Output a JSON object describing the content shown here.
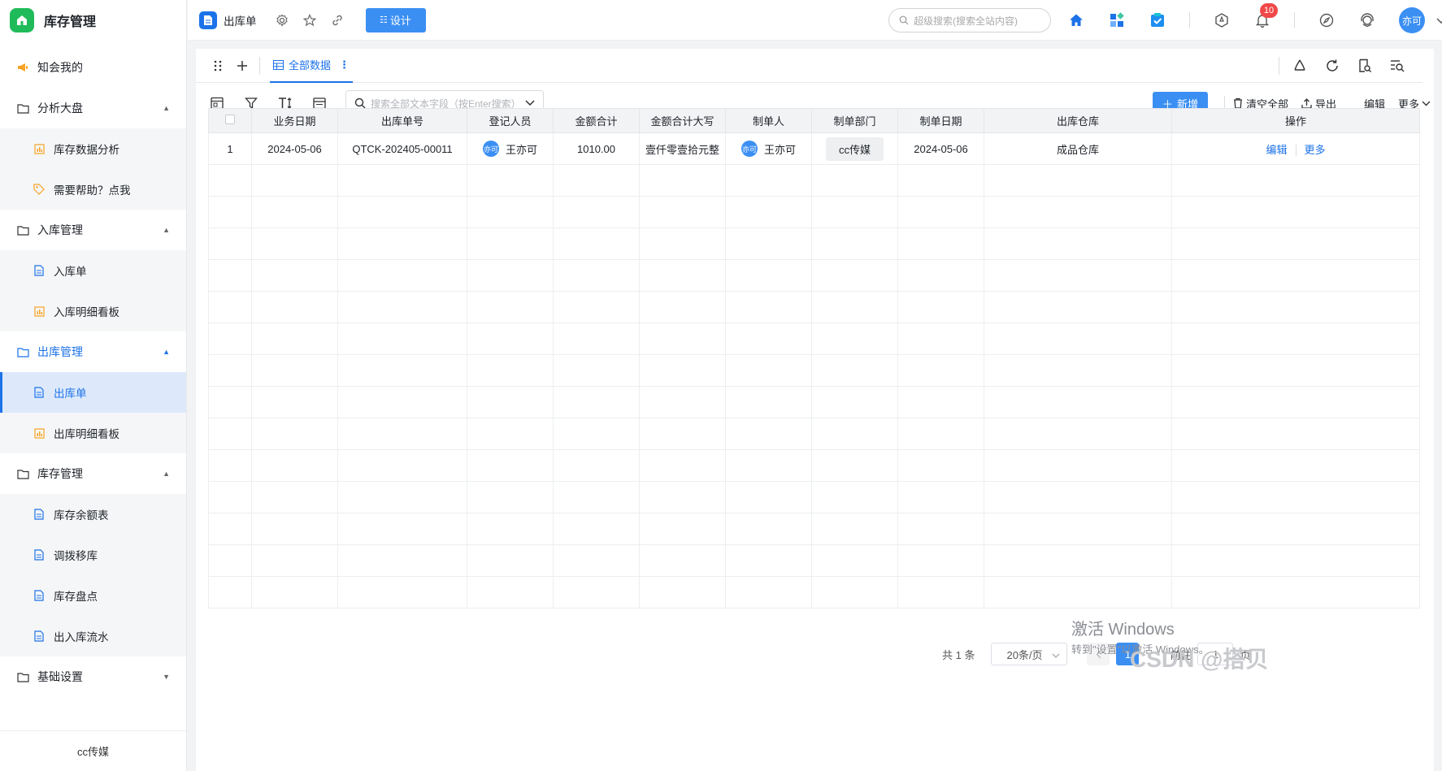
{
  "app": {
    "title": "库存管理",
    "footer": "cc传媒"
  },
  "sidebar": {
    "top_item": "知会我的",
    "groups": [
      {
        "label": "分析大盘",
        "items": [
          "库存数据分析",
          "需要帮助？点我"
        ]
      },
      {
        "label": "入库管理",
        "items": [
          "入库单",
          "入库明细看板"
        ]
      },
      {
        "label": "出库管理",
        "items": [
          "出库单",
          "出库明细看板"
        ]
      },
      {
        "label": "库存管理",
        "items": [
          "库存余额表",
          "调拨移库",
          "库存盘点",
          "出入库流水"
        ]
      },
      {
        "label": "基础设置",
        "items": []
      }
    ]
  },
  "topbar": {
    "page_name": "出库单",
    "design_label": "设计",
    "search_placeholder": "超级搜索(搜索全站内容)",
    "notification_count": "10",
    "avatar_text": "亦可"
  },
  "view": {
    "tab_label": "全部数据"
  },
  "toolbar": {
    "search_placeholder": "搜索全部文本字段（按Enter搜索）",
    "add_label": "新增",
    "clear_label": "清空全部",
    "export_label": "导出",
    "edit_label": "编辑",
    "more_label": "更多"
  },
  "table": {
    "columns": [
      "业务日期",
      "出库单号",
      "登记人员",
      "金额合计",
      "金额合计大写",
      "制单人",
      "制单部门",
      "制单日期",
      "出库仓库",
      "操作"
    ],
    "rows": [
      {
        "index": "1",
        "date": "2024-05-06",
        "order_no": "QTCK-202405-00011",
        "registrar_avatar": "亦可",
        "registrar": "王亦可",
        "amount": "1010.00",
        "amount_upper": "壹仟零壹拾元整",
        "creator_avatar": "亦可",
        "creator": "王亦可",
        "dept": "cc传媒",
        "create_date": "2024-05-06",
        "warehouse": "成品仓库",
        "op_edit": "编辑",
        "op_more": "更多"
      }
    ]
  },
  "pager": {
    "total": "共 1 条",
    "page_size": "20条/页",
    "current": "1",
    "goto": "前往",
    "goto_value": "1",
    "page_suffix": "页"
  },
  "overlay": {
    "win_line1": "激活 Windows",
    "win_line2": "转到\"设置\"以激活 Windows。",
    "csdn": "CSDN @搭贝"
  }
}
